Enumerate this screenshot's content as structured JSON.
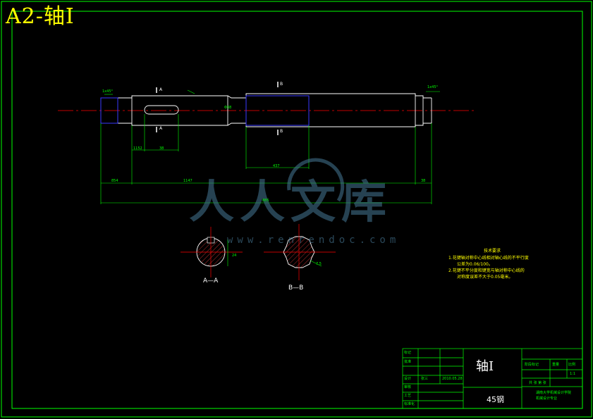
{
  "sheet_title": "A2-轴I",
  "watermark": {
    "brand": "人人文库",
    "url": "www.renrendoc.com"
  },
  "dimensions": {
    "chamfer_left": "1x45°",
    "chamfer_right": "1x45°",
    "keyway_offset": "1152",
    "keyway_length": "38",
    "seg_left": "854",
    "seg_mid": "1147",
    "seg_bb": "437",
    "seg_right": "38",
    "overall": "885",
    "dia_mid": "Φ38",
    "sec_a_dim": "24",
    "sec_b_dim": "7.5"
  },
  "sections": {
    "a_mark": "A",
    "b_mark": "B",
    "a_label": "A—A",
    "b_label": "B—B"
  },
  "tech_notes": {
    "heading": "技术要求",
    "line1": "1.花键轴对称中心线相对轴心线的不平行度",
    "line1b": "公差为0.06/100。",
    "line2": "2.花键不平分度和键宽与轴对称中心线的",
    "line2b": "对称度误差不大于0.05毫米。"
  },
  "title_block": {
    "part_name": "轴I",
    "material": "45钢",
    "row_labels": [
      "标记",
      "设计",
      "审核",
      "工艺",
      "标准化",
      "批准"
    ],
    "designer": "张三",
    "date": "2010.05.28",
    "stage_label": "阶段标记",
    "weight_label": "重量",
    "scale_label": "比例",
    "scale_value": "1:1",
    "sheet_label": "共 张 第 张",
    "school": "湖南大学机械设计学院",
    "dept": "机械设计专业"
  }
}
